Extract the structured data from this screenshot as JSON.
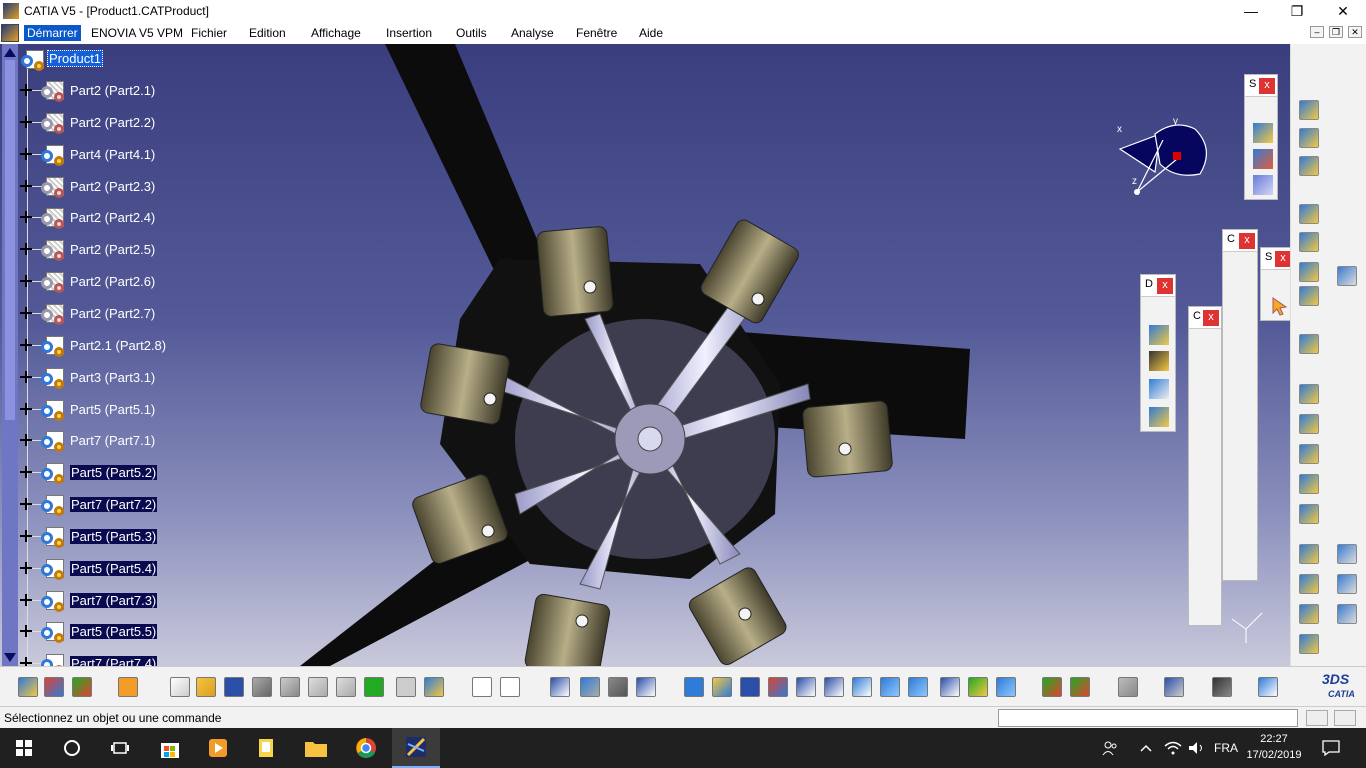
{
  "window": {
    "title": "CATIA V5 - [Product1.CATProduct]",
    "controls": {
      "minimize": "—",
      "maximize": "❐",
      "close": "✕"
    }
  },
  "menu": {
    "items": [
      "Démarrer",
      "ENOVIA V5 VPM",
      "Fichier",
      "Edition",
      "Affichage",
      "Insertion",
      "Outils",
      "Analyse",
      "Fenêtre",
      "Aide"
    ],
    "active_index": 0,
    "mdi": {
      "minimize": "–",
      "restore": "❐",
      "close": "✕"
    }
  },
  "tree": {
    "root": "Product1",
    "items": [
      {
        "label": "Part2 (Part2.1)",
        "icon": "part-gray-icon",
        "selected": false
      },
      {
        "label": "Part2 (Part2.2)",
        "icon": "part-gray-icon",
        "selected": false
      },
      {
        "label": "Part4 (Part4.1)",
        "icon": "part-icon",
        "selected": false
      },
      {
        "label": "Part2 (Part2.3)",
        "icon": "part-gray-icon",
        "selected": false
      },
      {
        "label": "Part2 (Part2.4)",
        "icon": "part-gray-icon",
        "selected": false
      },
      {
        "label": "Part2 (Part2.5)",
        "icon": "part-gray-icon",
        "selected": false
      },
      {
        "label": "Part2 (Part2.6)",
        "icon": "part-gray-icon",
        "selected": false
      },
      {
        "label": "Part2 (Part2.7)",
        "icon": "part-gray-icon",
        "selected": false
      },
      {
        "label": "Part2.1 (Part2.8)",
        "icon": "part-icon",
        "selected": false
      },
      {
        "label": "Part3 (Part3.1)",
        "icon": "part-icon",
        "selected": false
      },
      {
        "label": "Part5 (Part5.1)",
        "icon": "part-icon",
        "selected": false
      },
      {
        "label": "Part7 (Part7.1)",
        "icon": "part-icon",
        "selected": false
      },
      {
        "label": "Part5 (Part5.2)",
        "icon": "part-icon",
        "selected": true
      },
      {
        "label": "Part7 (Part7.2)",
        "icon": "part-icon",
        "selected": true
      },
      {
        "label": "Part5 (Part5.3)",
        "icon": "part-icon",
        "selected": true
      },
      {
        "label": "Part5 (Part5.4)",
        "icon": "part-icon",
        "selected": true
      },
      {
        "label": "Part7 (Part7.3)",
        "icon": "part-icon",
        "selected": true
      },
      {
        "label": "Part5 (Part5.5)",
        "icon": "part-icon",
        "selected": true
      },
      {
        "label": "Part7 (Part7.4)",
        "icon": "part-icon",
        "selected": true
      }
    ]
  },
  "compass": {
    "x_label": "x",
    "y_label": "y",
    "z_label": "z"
  },
  "floating_toolbars": [
    {
      "label": "S",
      "close": "x"
    },
    {
      "label": "C",
      "close": "x"
    },
    {
      "label": "S",
      "close": "x"
    },
    {
      "label": "D",
      "close": "x"
    },
    {
      "label": "C",
      "close": "x"
    }
  ],
  "status": {
    "message": "Sélectionnez un objet ou une commande",
    "command_input": ""
  },
  "catia_logo": {
    "ds": "3DS",
    "brand": "CATIA"
  },
  "taskbar": {
    "language": "FRA",
    "time": "22:27",
    "date": "17/02/2019"
  },
  "colors": {
    "viewport_top": "#3a3e7e",
    "viewport_bottom": "#c9c9db",
    "selection": "#1560d8",
    "close_red": "#dd3333"
  }
}
